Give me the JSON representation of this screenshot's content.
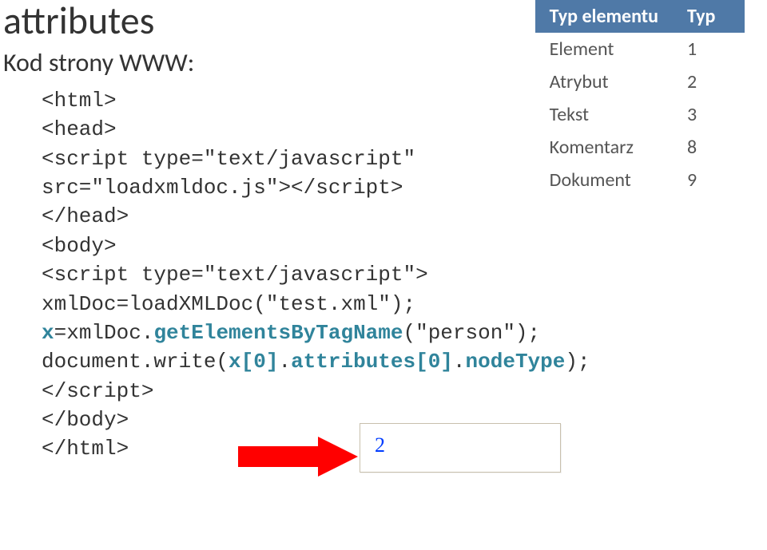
{
  "title": "attributes",
  "subtitle": "Kod strony WWW:",
  "code": {
    "l1": "<html>",
    "l2": "<head>",
    "l3": "<script type=\"text/javascript\"",
    "l4": "src=\"loadxmldoc.js\"></script>",
    "l5": "</head>",
    "l6": "<body>",
    "l7": "<script type=\"text/javascript\">",
    "l8": "xmlDoc=loadXMLDoc(\"test.xml\");",
    "l9a": "x",
    "l9b": "=xmlDoc.",
    "l9c": "getElementsByTagName",
    "l9d": "(\"person\");",
    "l10a": "document.write(",
    "l10b": "x[0]",
    "l10c": ".",
    "l10d": "attributes[0]",
    "l10e": ".",
    "l10f": "nodeType",
    "l10g": ");",
    "l11": "</script>",
    "l12": "</body>",
    "l13": "</html>"
  },
  "table": {
    "header1": "Typ elementu",
    "header2": "Typ",
    "rows": [
      {
        "name": "Element",
        "val": "1"
      },
      {
        "name": "Atrybut",
        "val": "2"
      },
      {
        "name": "Tekst",
        "val": "3"
      },
      {
        "name": "Komentarz",
        "val": "8"
      },
      {
        "name": "Dokument",
        "val": "9"
      }
    ]
  },
  "result": "2"
}
